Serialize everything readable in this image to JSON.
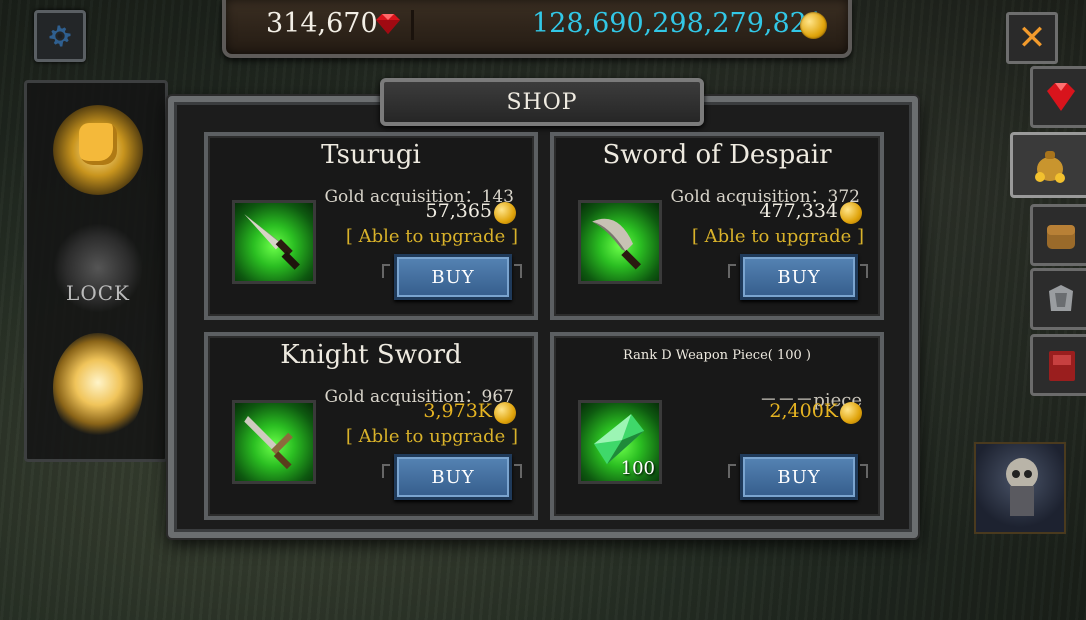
{
  "currency": {
    "gems": "314,670",
    "gold": "128,690,298,279,821"
  },
  "left_panel": {
    "lock_label": "LOCK"
  },
  "shop": {
    "title": "SHOP",
    "items": [
      {
        "name": "Tsurugi",
        "acquisition": "Gold acquisition：143",
        "price": "57,365",
        "upgrade": "[ Able to upgrade ]",
        "buy_label": "BUY",
        "icon": "sword-icon"
      },
      {
        "name": "Sword of Despair",
        "acquisition": "Gold acquisition：372",
        "price": "477,334",
        "upgrade": "[ Able to upgrade ]",
        "buy_label": "BUY",
        "icon": "curved-blade-icon"
      },
      {
        "name": "Knight Sword",
        "acquisition": "Gold acquisition：967",
        "price": "3,973K",
        "upgrade": "[ Able to upgrade ]",
        "buy_label": "BUY",
        "icon": "knight-sword-icon"
      },
      {
        "name": "Rank D Weapon Piece( 100 )",
        "piece": "－－－piece",
        "price": "2,400K",
        "quantity": "100",
        "buy_label": "BUY",
        "icon": "green-crystal-icon"
      }
    ]
  },
  "colors": {
    "gold_count": "#32c7e6",
    "price_gold": "#e6b422",
    "upgrade": "#d9b22a",
    "buy_button": "#4472a0",
    "close_x": "#f29a2c"
  },
  "right_tabs": [
    "ruby-icon",
    "gold-bag-icon",
    "leather-bag-icon",
    "armor-icon",
    "book-icon"
  ]
}
